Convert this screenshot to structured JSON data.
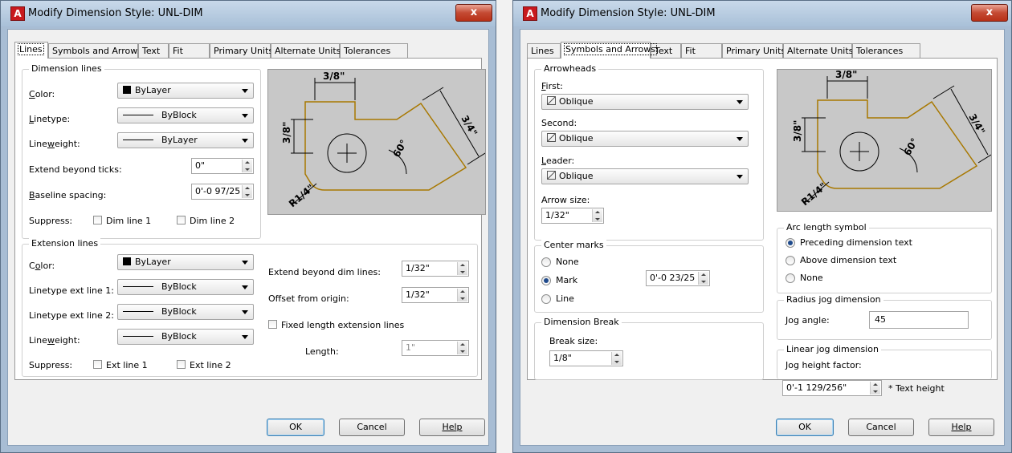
{
  "title": "Modify Dimension Style: UNL-DIM",
  "app_icon": "A",
  "close_label": "x",
  "tabs": [
    "Lines",
    "Symbols and Arrows",
    "Text",
    "Fit",
    "Primary Units",
    "Alternate Units",
    "Tolerances"
  ],
  "buttons": {
    "ok": "OK",
    "cancel": "Cancel",
    "help": "Help"
  },
  "preview": {
    "top_dim": "3/8\"",
    "left_dim": "3/8\"",
    "right_dim": "3/4\"",
    "angle": "60°",
    "radius": "R1/4\""
  },
  "left": {
    "active_tab": "Lines",
    "dimension_lines": {
      "group": "Dimension lines",
      "color_label": "Color:",
      "color_value": "ByLayer",
      "linetype_label": "Linetype:",
      "linetype_value": "ByBlock",
      "lineweight_label": "Lineweight:",
      "lineweight_value": "ByLayer",
      "extend_label": "Extend beyond ticks:",
      "extend_value": "0\"",
      "baseline_label": "Baseline spacing:",
      "baseline_value": "0'-0 97/25",
      "suppress_label": "Suppress:",
      "dim1": "Dim line 1",
      "dim2": "Dim line 2"
    },
    "extension_lines": {
      "group": "Extension lines",
      "color_label": "Color:",
      "color_value": "ByLayer",
      "lt1_label": "Linetype ext line 1:",
      "lt1_value": "ByBlock",
      "lt2_label": "Linetype ext line 2:",
      "lt2_value": "ByBlock",
      "lineweight_label": "Lineweight:",
      "lineweight_value": "ByBlock",
      "suppress_label": "Suppress:",
      "ext1": "Ext line 1",
      "ext2": "Ext line 2",
      "extend_label": "Extend beyond dim lines:",
      "extend_value": "1/32\"",
      "offset_label": "Offset from origin:",
      "offset_value": "1/32\"",
      "fixed_label": "Fixed length extension lines",
      "length_label": "Length:",
      "length_value": "1\""
    }
  },
  "right": {
    "active_tab": "Symbols and Arrows",
    "arrowheads": {
      "group": "Arrowheads",
      "first_label": "First:",
      "first_value": "Oblique",
      "second_label": "Second:",
      "second_value": "Oblique",
      "leader_label": "Leader:",
      "leader_value": "Oblique",
      "size_label": "Arrow size:",
      "size_value": "1/32\""
    },
    "center_marks": {
      "group": "Center marks",
      "none": "None",
      "mark": "Mark",
      "line": "Line",
      "selected": "Mark",
      "size_value": "0'-0 23/25"
    },
    "dimension_break": {
      "group": "Dimension Break",
      "size_label": "Break size:",
      "size_value": "1/8\""
    },
    "arc_length": {
      "group": "Arc length symbol",
      "preceding": "Preceding dimension text",
      "above": "Above dimension text",
      "none": "None",
      "selected": "Preceding dimension text"
    },
    "radius_jog": {
      "group": "Radius jog dimension",
      "angle_label": "Jog angle:",
      "angle_value": "45"
    },
    "linear_jog": {
      "group": "Linear jog dimension",
      "factor_label": "Jog height factor:",
      "factor_value": "0'-1 129/256\"",
      "suffix": "* Text height"
    }
  }
}
